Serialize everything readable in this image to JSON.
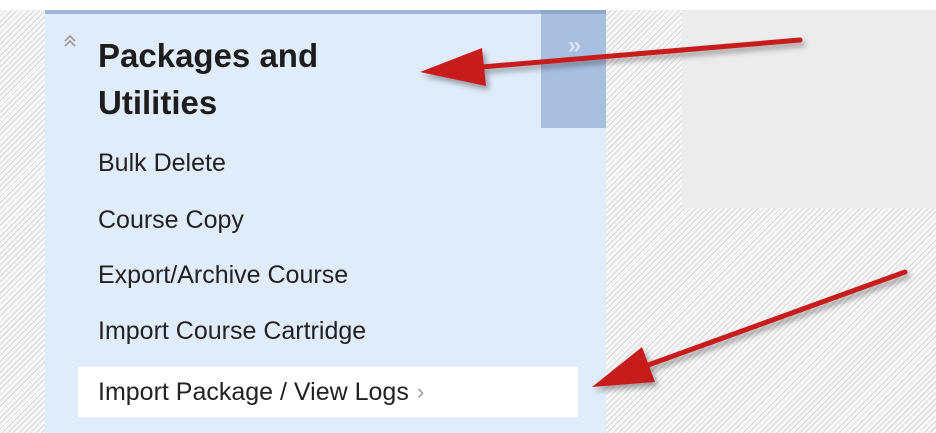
{
  "panel": {
    "title": "Packages and Utilities",
    "collapse_glyph": "»",
    "expand_glyph": "⌃",
    "items": [
      {
        "label": "Bulk Delete"
      },
      {
        "label": "Course Copy"
      },
      {
        "label": "Export/Archive Course"
      },
      {
        "label": "Import Course Cartridge"
      },
      {
        "label": "Import Package / View Logs",
        "selected": true,
        "chevron": "›"
      }
    ]
  },
  "annotation": {
    "arrow_color": "#c81e1e"
  },
  "icons": {
    "expand": "double-chevron-up-icon",
    "collapse": "double-chevron-right-icon",
    "item_chevron": "chevron-right-icon"
  }
}
